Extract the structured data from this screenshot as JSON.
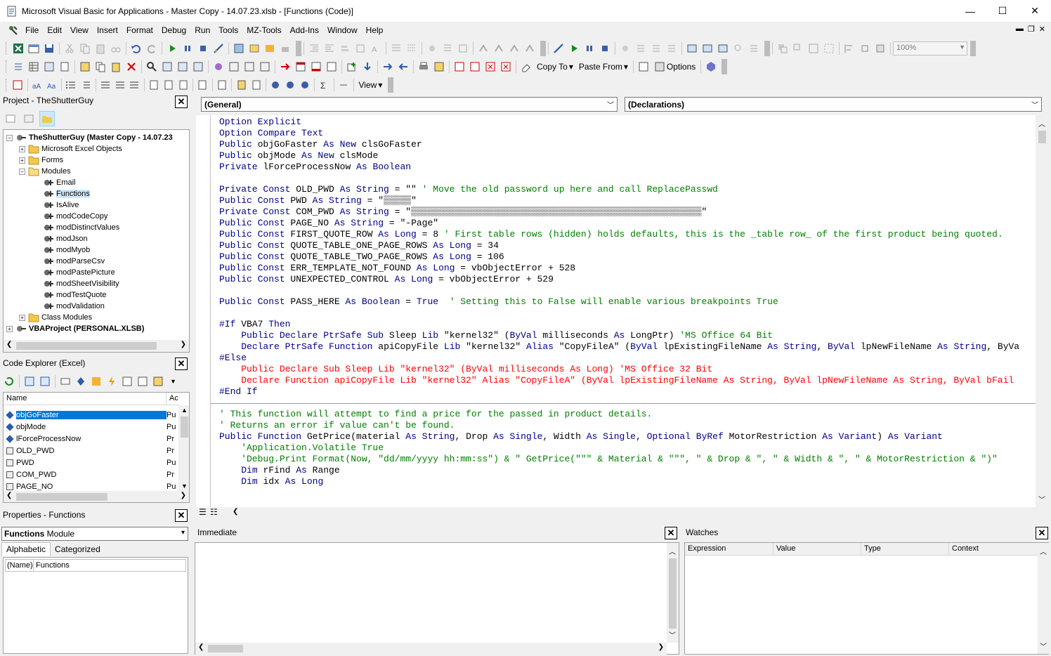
{
  "window": {
    "title": "Microsoft Visual Basic for Applications - Master Copy - 14.07.23.xlsb - [Functions (Code)]",
    "minimize": "—",
    "maximize": "☐",
    "close": "✕"
  },
  "menu": {
    "items": [
      "File",
      "Edit",
      "View",
      "Insert",
      "Format",
      "Debug",
      "Run",
      "Tools",
      "MZ-Tools",
      "Add-Ins",
      "Window",
      "Help"
    ],
    "mdi_min": "▬",
    "mdi_restore": "❐",
    "mdi_close": "✕"
  },
  "toolbar": {
    "zoom": "100%",
    "copy_to": "Copy To",
    "paste_from": "Paste From",
    "options": "Options",
    "view": "View"
  },
  "project": {
    "title": "Project - TheShutterGuy",
    "root": "TheShutterGuy (Master Copy - 14.07.23",
    "folders": [
      "Microsoft Excel Objects",
      "Forms",
      "Modules"
    ],
    "modules": [
      "Email",
      "Functions",
      "IsAlive",
      "modCodeCopy",
      "modDistinctValues",
      "modJson",
      "modMyob",
      "modParseCsv",
      "modPastePicture",
      "modSheetVisibility",
      "modTestQuote",
      "modValidation"
    ],
    "class_modules": "Class Modules",
    "personal": "VBAProject (PERSONAL.XLSB)"
  },
  "code_explorer": {
    "title": "Code Explorer (Excel)",
    "col_name": "Name",
    "col_access": "Ac",
    "rows": [
      {
        "name": "objGoFaster",
        "access": "Pu"
      },
      {
        "name": "objMode",
        "access": "Pu"
      },
      {
        "name": "lForceProcessNow",
        "access": "Pr"
      },
      {
        "name": "OLD_PWD",
        "access": "Pr"
      },
      {
        "name": "PWD",
        "access": "Pu"
      },
      {
        "name": "COM_PWD",
        "access": "Pr"
      },
      {
        "name": "PAGE_NO",
        "access": "Pu"
      }
    ]
  },
  "properties": {
    "title": "Properties - Functions",
    "object": "Functions",
    "object_type": "Module",
    "tab_alpha": "Alphabetic",
    "tab_cat": "Categorized",
    "prop_name": "(Name)",
    "prop_value": "Functions"
  },
  "code": {
    "object_combo": "(General)",
    "proc_combo": "(Declarations)",
    "lines": [
      [
        [
          "kw",
          "Option Explicit"
        ]
      ],
      [
        [
          "kw",
          "Option Compare Text"
        ]
      ],
      [
        [
          "kw",
          "Public "
        ],
        [
          "",
          "objGoFaster "
        ],
        [
          "kw",
          "As New "
        ],
        [
          "",
          "clsGoFaster"
        ]
      ],
      [
        [
          "kw",
          "Public "
        ],
        [
          "",
          "objMode "
        ],
        [
          "kw",
          "As New "
        ],
        [
          "",
          "clsMode"
        ]
      ],
      [
        [
          "kw",
          "Private "
        ],
        [
          "",
          "lForceProcessNow "
        ],
        [
          "kw",
          "As Boolean"
        ]
      ],
      [],
      [
        [
          "kw",
          "Private Const "
        ],
        [
          "",
          "OLD_PWD "
        ],
        [
          "kw",
          "As String "
        ],
        [
          "",
          "= \"\" "
        ],
        [
          "cm",
          "' Move the old password up here and call ReplacePasswd"
        ]
      ],
      [
        [
          "kw",
          "Public Const "
        ],
        [
          "",
          "PWD "
        ],
        [
          "kw",
          "As String "
        ],
        [
          "",
          "= \"▒▒▒▒▒\""
        ]
      ],
      [
        [
          "kw",
          "Private Const "
        ],
        [
          "",
          "COM_PWD "
        ],
        [
          "kw",
          "As String "
        ],
        [
          "",
          "= \"▒▒▒▒▒▒▒▒▒▒▒▒▒▒▒▒▒▒▒▒▒▒▒▒▒▒▒▒▒▒▒▒▒▒▒▒▒▒▒▒▒▒▒▒▒▒▒▒▒▒▒▒▒\""
        ]
      ],
      [
        [
          "kw",
          "Public Const "
        ],
        [
          "",
          "PAGE_NO "
        ],
        [
          "kw",
          "As String "
        ],
        [
          "",
          "= \"-Page\""
        ]
      ],
      [
        [
          "kw",
          "Public Const "
        ],
        [
          "",
          "FIRST_QUOTE_ROW "
        ],
        [
          "kw",
          "As Long "
        ],
        [
          "",
          "= 8 "
        ],
        [
          "cm",
          "' First table rows (hidden) holds defaults, this is the _table row_ of the first product being quoted."
        ]
      ],
      [
        [
          "kw",
          "Public Const "
        ],
        [
          "",
          "QUOTE_TABLE_ONE_PAGE_ROWS "
        ],
        [
          "kw",
          "As Long "
        ],
        [
          "",
          "= 34"
        ]
      ],
      [
        [
          "kw",
          "Public Const "
        ],
        [
          "",
          "QUOTE_TABLE_TWO_PAGE_ROWS "
        ],
        [
          "kw",
          "As Long "
        ],
        [
          "",
          "= 106"
        ]
      ],
      [
        [
          "kw",
          "Public Const "
        ],
        [
          "",
          "ERR_TEMPLATE_NOT_FOUND "
        ],
        [
          "kw",
          "As Long "
        ],
        [
          "",
          "= vbObjectError + 528"
        ]
      ],
      [
        [
          "kw",
          "Public Const "
        ],
        [
          "",
          "UNEXPECTED_CONTROL "
        ],
        [
          "kw",
          "As Long "
        ],
        [
          "",
          "= vbObjectError + 529"
        ]
      ],
      [],
      [
        [
          "kw",
          "Public Const "
        ],
        [
          "",
          "PASS_HERE "
        ],
        [
          "kw",
          "As Boolean "
        ],
        [
          "",
          "= "
        ],
        [
          "kw",
          "True  "
        ],
        [
          "cm",
          "' Setting this to False will enable various breakpoints True"
        ]
      ],
      [],
      [
        [
          "kw",
          "#If "
        ],
        [
          "",
          "VBA7 "
        ],
        [
          "kw",
          "Then"
        ]
      ],
      [
        [
          "",
          "    "
        ],
        [
          "kw",
          "Public Declare PtrSafe Sub "
        ],
        [
          "",
          "Sleep "
        ],
        [
          "kw",
          "Lib "
        ],
        [
          "",
          "\"kernel32\" ("
        ],
        [
          "kw",
          "ByVal "
        ],
        [
          "",
          "milliseconds "
        ],
        [
          "kw",
          "As "
        ],
        [
          "",
          "LongPtr) "
        ],
        [
          "cm",
          "'MS Office 64 Bit"
        ]
      ],
      [
        [
          "",
          "    "
        ],
        [
          "kw",
          "Declare PtrSafe Function "
        ],
        [
          "",
          "apiCopyFile "
        ],
        [
          "kw",
          "Lib "
        ],
        [
          "",
          "\"kernel32\" "
        ],
        [
          "kw",
          "Alias "
        ],
        [
          "",
          "\"CopyFileA\" ("
        ],
        [
          "kw",
          "ByVal "
        ],
        [
          "",
          "lpExistingFileName "
        ],
        [
          "kw",
          "As String"
        ],
        [
          ",",
          ", "
        ],
        [
          "kw",
          "ByVal "
        ],
        [
          "",
          "lpNewFileName "
        ],
        [
          "kw",
          "As String"
        ],
        [
          "",
          ", ByVa"
        ]
      ],
      [
        [
          "kw",
          "#Else"
        ]
      ],
      [
        [
          "er",
          "    Public Declare Sub Sleep Lib \"kernel32\" (ByVal milliseconds As Long) 'MS Office 32 Bit"
        ]
      ],
      [
        [
          "er",
          "    Declare Function apiCopyFile Lib \"kernel32\" Alias \"CopyFileA\" (ByVal lpExistingFileName As String, ByVal lpNewFileName As String, ByVal bFail"
        ]
      ],
      [
        [
          "kw",
          "#End If"
        ]
      ],
      [],
      [
        [
          "cm",
          "' This function will attempt to find a price for the passed in product details."
        ]
      ],
      [
        [
          "cm",
          "' Returns an error if value can't be found."
        ]
      ],
      [
        [
          "kw",
          "Public Function "
        ],
        [
          "",
          "GetPrice(material "
        ],
        [
          "kw",
          "As String"
        ],
        [
          "",
          ", Drop "
        ],
        [
          "kw",
          "As Single"
        ],
        [
          "",
          ", Width "
        ],
        [
          "kw",
          "As Single"
        ],
        [
          "",
          ", "
        ],
        [
          "kw",
          "Optional ByRef "
        ],
        [
          "",
          "MotorRestriction "
        ],
        [
          "kw",
          "As Variant"
        ],
        [
          "",
          ") "
        ],
        [
          "kw",
          "As Variant"
        ]
      ],
      [
        [
          "cm",
          "    'Application.Volatile True"
        ]
      ],
      [
        [
          "cm",
          "    'Debug.Print Format(Now, \"dd/mm/yyyy hh:mm:ss\") & \" GetPrice(\"\"\" & Material & \"\"\", \" & Drop & \", \" & Width & \", \" & MotorRestriction & \")\""
        ]
      ],
      [
        [
          "",
          "    "
        ],
        [
          "kw",
          "Dim "
        ],
        [
          "",
          "rFind "
        ],
        [
          "kw",
          "As "
        ],
        [
          "",
          "Range"
        ]
      ],
      [
        [
          "",
          "    "
        ],
        [
          "kw",
          "Dim "
        ],
        [
          "",
          "idx "
        ],
        [
          "kw",
          "As Long"
        ]
      ]
    ]
  },
  "immediate": {
    "title": "Immediate"
  },
  "watches": {
    "title": "Watches",
    "columns": [
      "Expression",
      "Value",
      "Type",
      "Context"
    ]
  },
  "colors": {
    "keyword": "#00008b",
    "comment": "#008000",
    "error": "#ff0000",
    "selection": "#0078d7"
  }
}
